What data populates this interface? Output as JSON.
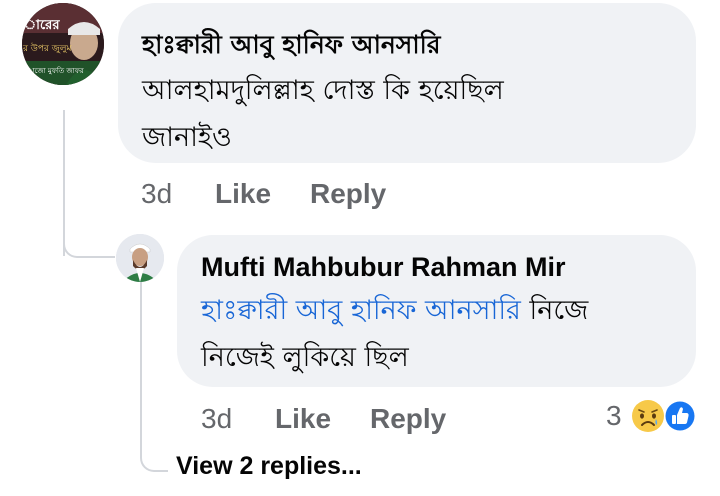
{
  "comment": {
    "author": "হাঃক্বারী আবু হানিফ আনসারি",
    "text_line1": "আলহামদুলিল্লাহ দোস্ত কি হয়েছিল",
    "text_line2": "জানাইও",
    "time": "3d",
    "like_label": "Like",
    "reply_label": "Reply",
    "avatar_text_top": "ারের",
    "avatar_text_mid": "র উপর জুলুম",
    "avatar_text_bottom": "াজো মুফতি জাফর"
  },
  "reply": {
    "author": "Mufti Mahbubur Rahman Mir",
    "mention": "হাঃক্বারী আবু হানিফ আনসারি",
    "text_rest": " নিজে",
    "text_line2": "নিজেই লুকিয়ে ছিল",
    "time": "3d",
    "like_label": "Like",
    "reply_label": "Reply",
    "reaction_count": "3",
    "reaction_icons": [
      "sad-emoji-icon",
      "like-thumb-icon"
    ]
  },
  "view_replies": "View 2 replies...",
  "colors": {
    "bubble": "#f0f2f5",
    "mention": "#1866d6",
    "meta": "#65676b",
    "like_blue": "#1877f2",
    "sad_yellow": "#f7c948"
  }
}
